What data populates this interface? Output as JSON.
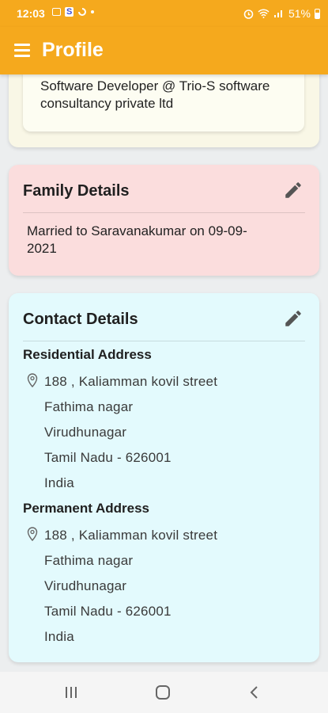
{
  "status_bar": {
    "time": "12:03",
    "battery_percent": "51%",
    "left_icons": [
      "gallery-icon",
      "s-app-icon",
      "loop-icon",
      "dot-icon"
    ],
    "right_icons": [
      "alarm-icon",
      "wifi-icon",
      "signal-icon",
      "battery-icon"
    ]
  },
  "app_bar": {
    "title": "Profile",
    "menu_icon": "hamburger-menu-icon",
    "background": "#F5A91D"
  },
  "work": {
    "text": "Software Developer @  Trio-S software consultancy private ltd"
  },
  "family": {
    "title": "Family Details",
    "text": "Married to Saravanakumar  on 09-09-2021",
    "edit_icon": "pencil-icon",
    "background": "#FBDDDD"
  },
  "contact": {
    "title": "Contact Details",
    "edit_icon": "pencil-icon",
    "background": "#E3FAFD",
    "residential": {
      "label": "Residential Address",
      "lines": [
        "188 , Kaliamman kovil street",
        "Fathima nagar",
        "Virudhunagar",
        "Tamil Nadu - 626001",
        "India"
      ]
    },
    "permanent": {
      "label": "Permanent Address",
      "lines": [
        "188 , Kaliamman kovil street",
        "Fathima nagar",
        "Virudhunagar",
        "Tamil Nadu - 626001",
        "India"
      ]
    }
  },
  "nav_bar": {
    "buttons": [
      "recent-apps-icon",
      "home-icon",
      "back-icon"
    ]
  }
}
